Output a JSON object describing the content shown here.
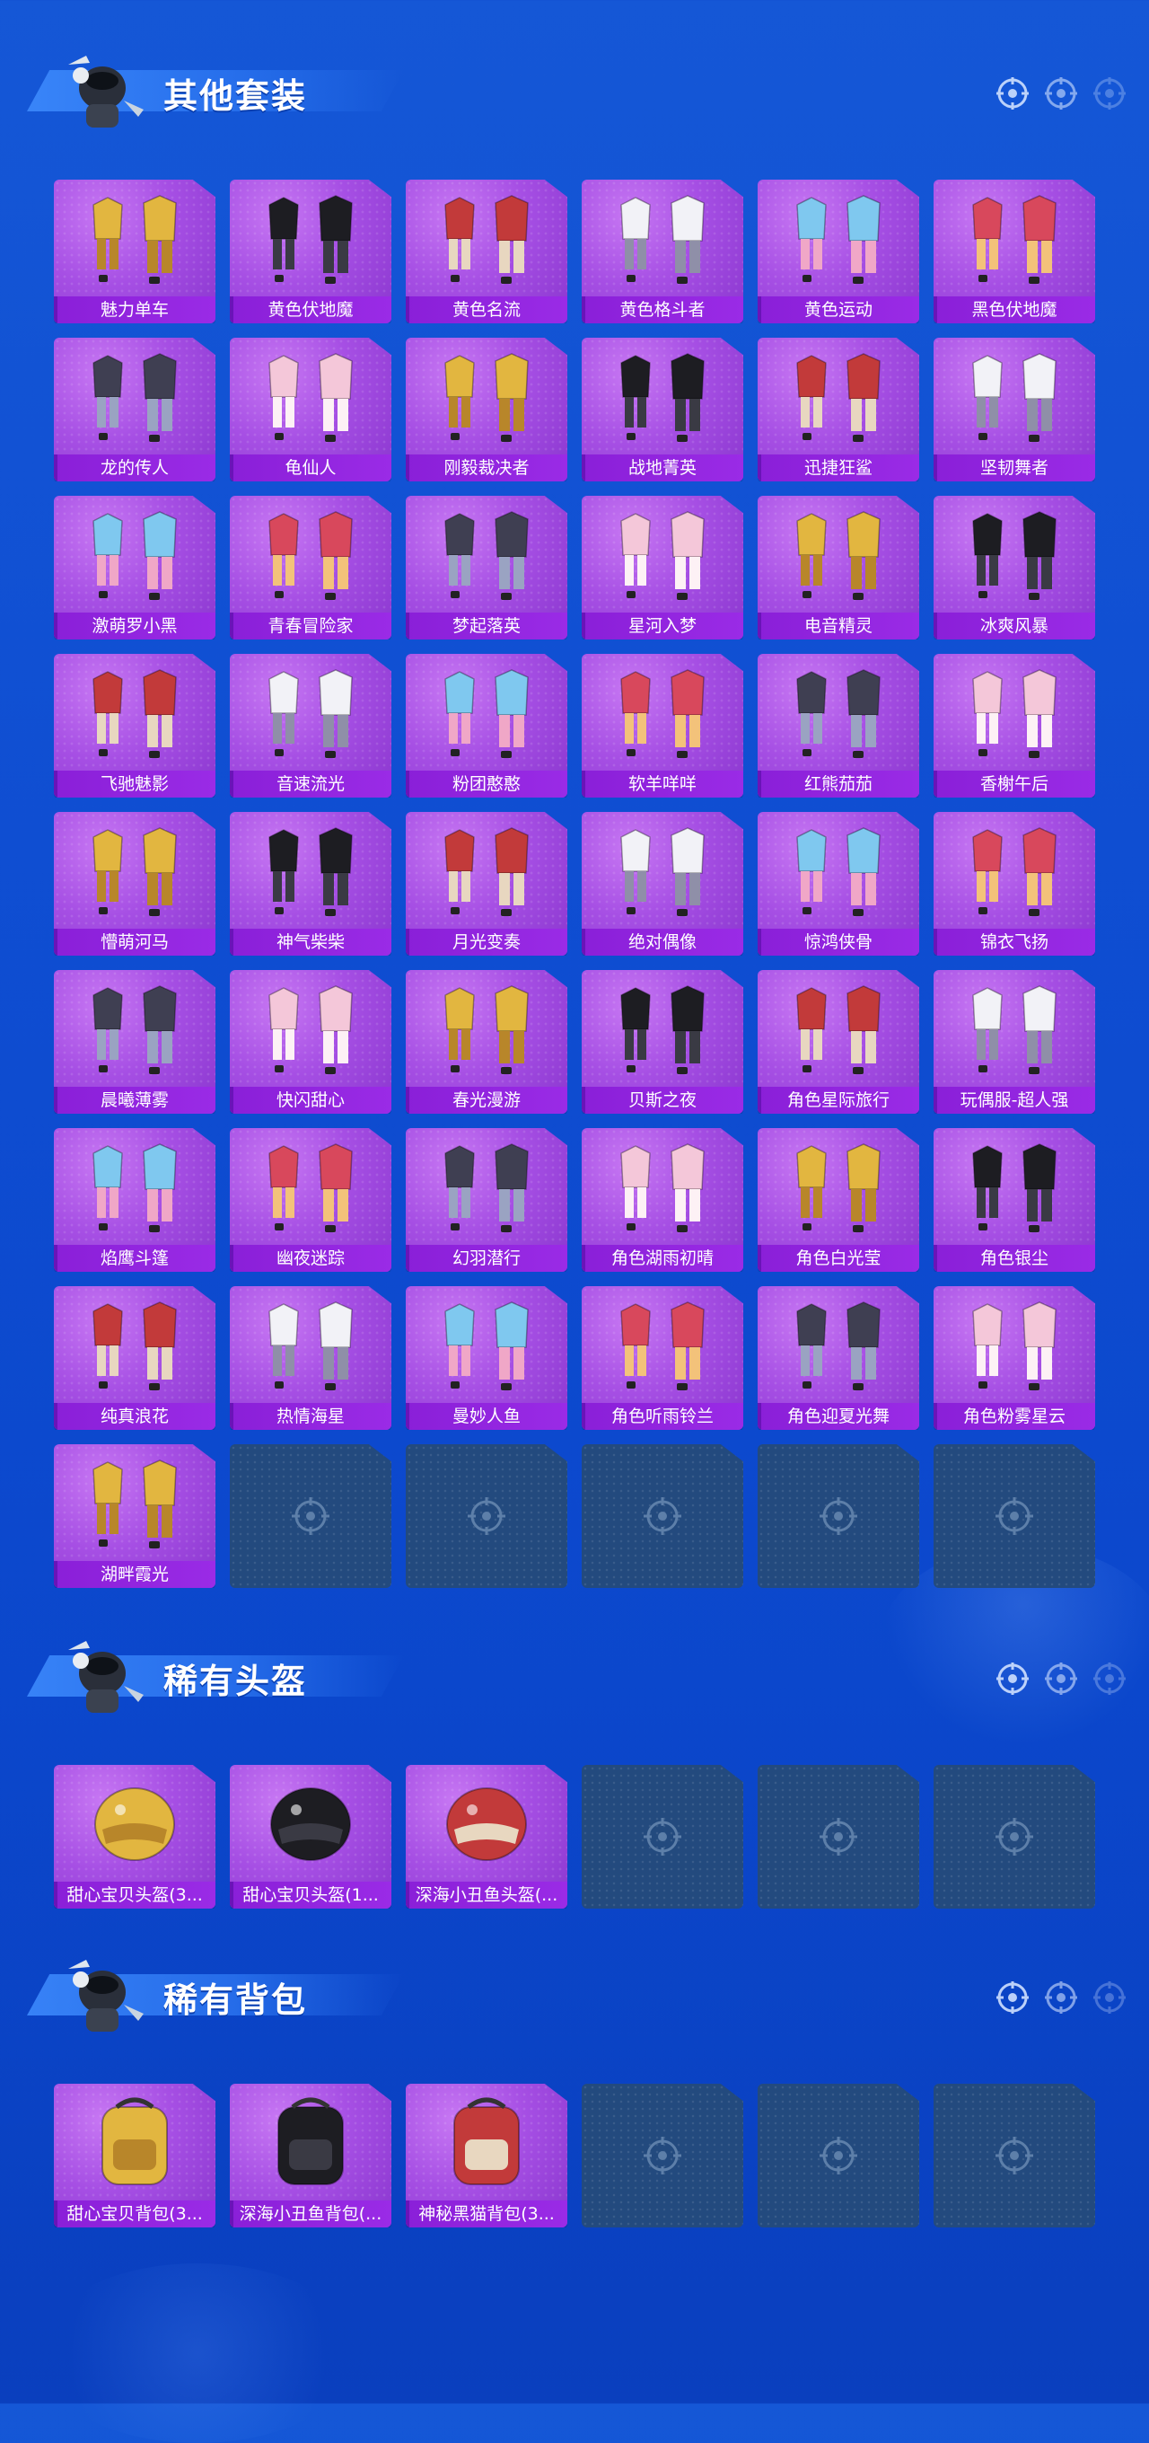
{
  "sections": [
    {
      "title": "其他套装",
      "items": [
        "魅力单车",
        "黄色伏地魔",
        "黄色名流",
        "黄色格斗者",
        "黄色运动",
        "黑色伏地魔",
        "龙的传人",
        "龟仙人",
        "刚毅裁决者",
        "战地菁英",
        "迅捷狂鲨",
        "坚韧舞者",
        "激萌罗小黑",
        "青春冒险家",
        "梦起落英",
        "星河入梦",
        "电音精灵",
        "冰爽风暴",
        "飞驰魅影",
        "音速流光",
        "粉团憨憨",
        "软羊咩咩",
        "红熊茄茄",
        "香榭午后",
        "懵萌河马",
        "神气柴柴",
        "月光变奏",
        "绝对偶像",
        "惊鸿侠骨",
        "锦衣飞扬",
        "晨曦薄雾",
        "快闪甜心",
        "春光漫游",
        "贝斯之夜",
        "角色星际旅行",
        "玩偶服-超人强",
        "焰鹰斗篷",
        "幽夜迷踪",
        "幻羽潜行",
        "角色湖雨初晴",
        "角色白光莹",
        "角色银尘",
        "纯真浪花",
        "热情海星",
        "曼妙人鱼",
        "角色听雨铃兰",
        "角色迎夏光舞",
        "角色粉雾星云",
        "湖畔霞光"
      ],
      "empty_slots": 5
    },
    {
      "title": "稀有头盔",
      "items": [
        "甜心宝贝头盔(3...",
        "甜心宝贝头盔(1...",
        "深海小丑鱼头盔(..."
      ],
      "empty_slots": 3
    },
    {
      "title": "稀有背包",
      "items": [
        "甜心宝贝背包(3...",
        "深海小丑鱼背包(...",
        "神秘黑猫背包(3..."
      ],
      "empty_slots": 3
    }
  ]
}
